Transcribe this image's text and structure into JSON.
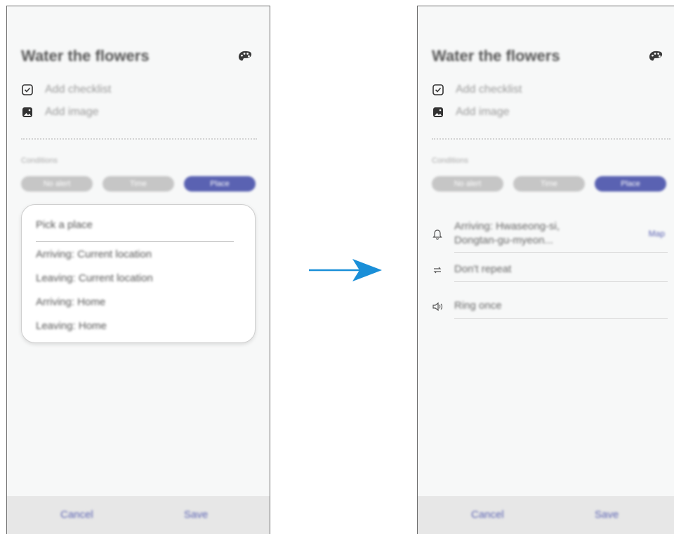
{
  "left": {
    "title": "Water the flowers",
    "add_checklist": "Add checklist",
    "add_image": "Add image",
    "conditions_label": "Conditions",
    "pills": [
      "No alert",
      "Time",
      "Place"
    ],
    "dropdown": {
      "header": "Pick a place",
      "options": [
        "Arriving: Current location",
        "Leaving: Current location",
        "Arriving: Home",
        "Leaving: Home"
      ]
    },
    "cancel": "Cancel",
    "save": "Save"
  },
  "right": {
    "title": "Water the flowers",
    "add_checklist": "Add checklist",
    "add_image": "Add image",
    "conditions_label": "Conditions",
    "pills": [
      "No alert",
      "Time",
      "Place"
    ],
    "place_line1": "Arriving: Hwaseong-si,",
    "place_line2": "Dongtan-gu-myeon...",
    "map_link": "Map",
    "repeat": "Don't repeat",
    "sound": "Ring once",
    "cancel": "Cancel",
    "save": "Save"
  },
  "colors": {
    "accent": "#5a62b2",
    "arrow": "#1a8fd8"
  }
}
